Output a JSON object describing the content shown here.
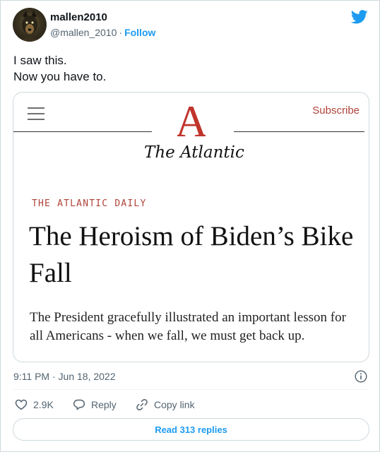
{
  "author": {
    "name": "mallen2010",
    "handle": "@mallen_2010",
    "separator": "·",
    "follow_label": "Follow"
  },
  "tweet": {
    "lines": [
      "I saw this.",
      "Now you have to."
    ]
  },
  "card": {
    "subscribe_label": "Subscribe",
    "logo_letter": "A",
    "logo_wordmark": "The Atlantic",
    "kicker": "THE ATLANTIC DAILY",
    "headline": "The Heroism of Biden’s Bike Fall",
    "deck": "The President gracefully illustrated an important lesson for all Americans - when we fall, we must get back up.",
    "accent_color": "#b0443a"
  },
  "meta": {
    "timestamp": "9:11 PM · Jun 18, 2022"
  },
  "actions": {
    "like_count": "2.9K",
    "reply_label": "Reply",
    "copy_label": "Copy link"
  },
  "read_replies_label": "Read 313 replies",
  "colors": {
    "twitter_blue": "#1d9bf0",
    "secondary_text": "#536471",
    "border": "#cfd9de"
  },
  "icons": [
    "twitter-bird-icon",
    "hamburger-menu-icon",
    "atlantic-logo-icon",
    "info-icon",
    "heart-icon",
    "reply-icon",
    "link-icon"
  ]
}
